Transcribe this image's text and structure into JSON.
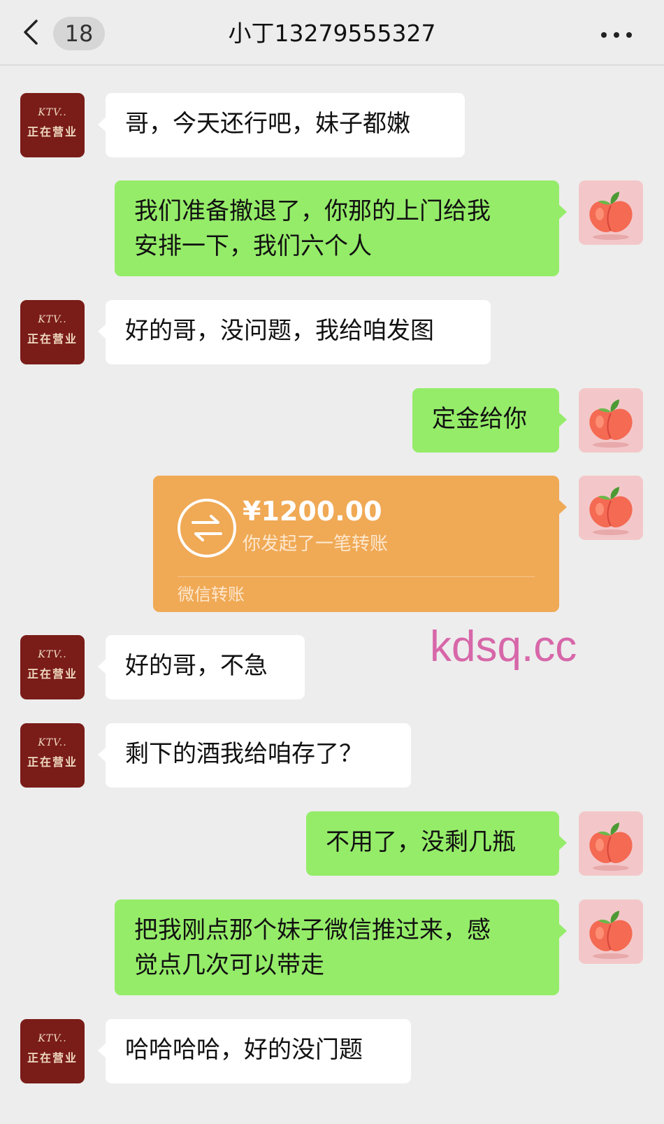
{
  "header": {
    "back_icon": "chevron-left-icon",
    "unread_count": "18",
    "title": "小丁13279555327",
    "more_icon": "more-dots-icon"
  },
  "avatars": {
    "contact": {
      "line1": "KTV..",
      "line2": "正在营业",
      "background": "#7a1c18"
    },
    "self": {
      "icon": "peach-icon"
    }
  },
  "messages": [
    {
      "from": "contact",
      "text": "哥，今天还行吧，妹子都嫩"
    },
    {
      "from": "self",
      "text": "我们准备撤退了，你那的上门给我\n安排一下，我们六个人"
    },
    {
      "from": "contact",
      "text": "好的哥，没问题，我给咱发图"
    },
    {
      "from": "self",
      "text": "定金给你"
    },
    {
      "from": "self",
      "type": "transfer",
      "amount": "¥1200.00",
      "desc": "你发起了一笔转账",
      "footer": "微信转账"
    },
    {
      "from": "contact",
      "text": "好的哥，不急"
    },
    {
      "from": "contact",
      "text": "剩下的酒我给咱存了？"
    },
    {
      "from": "self",
      "text": "不用了，没剩几瓶"
    },
    {
      "from": "self",
      "text": "把我刚点那个妹子微信推过来，感\n觉点几次可以带走"
    },
    {
      "from": "contact",
      "text": "哈哈哈哈，好的没门题"
    }
  ],
  "watermark": "kdsq.cc",
  "colors": {
    "background": "#ededed",
    "incoming_bubble": "#ffffff",
    "outgoing_bubble": "#95ec69",
    "transfer_card": "#f0a955",
    "watermark": "#d767a9"
  }
}
